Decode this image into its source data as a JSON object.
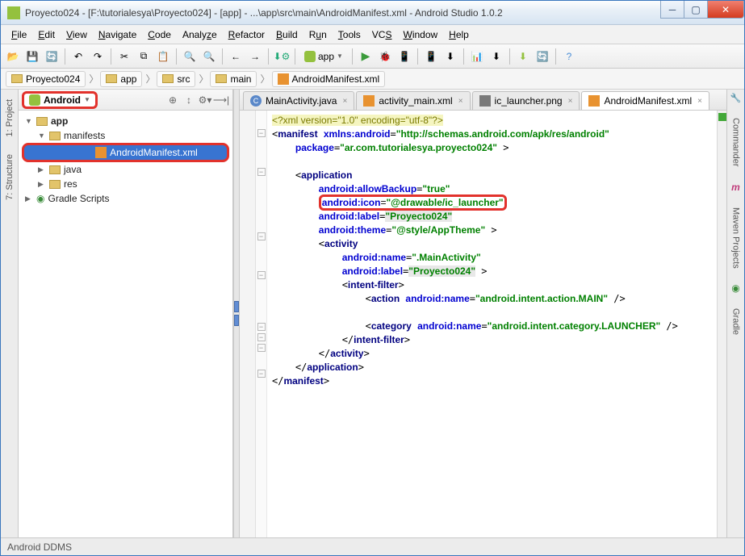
{
  "window": {
    "title": "Proyecto024 - [F:\\tutorialesya\\Proyecto024] - [app] - ...\\app\\src\\main\\AndroidManifest.xml - Android Studio 1.0.2"
  },
  "menu": {
    "file": "File",
    "edit": "Edit",
    "view": "View",
    "navigate": "Navigate",
    "code": "Code",
    "analyze": "Analyze",
    "refactor": "Refactor",
    "build": "Build",
    "run": "Run",
    "tools": "Tools",
    "vcs": "VCS",
    "window": "Window",
    "help": "Help"
  },
  "toolbar": {
    "module": "app"
  },
  "breadcrumbs": [
    {
      "label": "Proyecto024",
      "icon": "folder"
    },
    {
      "label": "app",
      "icon": "folder"
    },
    {
      "label": "src",
      "icon": "folder"
    },
    {
      "label": "main",
      "icon": "folder"
    },
    {
      "label": "AndroidManifest.xml",
      "icon": "xml"
    }
  ],
  "project_dropdown": "Android",
  "tree": {
    "root": "app",
    "manifests": "manifests",
    "manifest_file": "AndroidManifest.xml",
    "java": "java",
    "res": "res",
    "gradle": "Gradle Scripts"
  },
  "editor_tabs": [
    {
      "label": "MainActivity.java",
      "icon": "java",
      "active": false
    },
    {
      "label": "activity_main.xml",
      "icon": "xml",
      "active": false
    },
    {
      "label": "ic_launcher.png",
      "icon": "png",
      "active": false
    },
    {
      "label": "AndroidManifest.xml",
      "icon": "xml",
      "active": true
    }
  ],
  "left_tabs": [
    "1: Project",
    "7: Structure"
  ],
  "right_tabs": [
    "Commander",
    "Maven Projects",
    "Gradle"
  ],
  "status": "Android DDMS",
  "xml": {
    "decl": "<?xml version=\"1.0\" encoding=\"utf-8\"?>",
    "manifest_open": "manifest",
    "xmlns_attr": "xmlns:android",
    "xmlns_val": "\"http://schemas.android.com/apk/res/android\"",
    "package_attr": "package",
    "package_val": "\"ar.com.tutorialesya.proyecto024\"",
    "app": "application",
    "allowBackup_attr": "android:allowBackup",
    "allowBackup_val": "\"true\"",
    "icon_attr": "android:icon",
    "icon_val": "\"@drawable/ic_launcher\"",
    "label_attr": "android:label",
    "label_val": "\"Proyecto024\"",
    "theme_attr": "android:theme",
    "theme_val": "\"@style/AppTheme\"",
    "activity": "activity",
    "act_name_attr": "android:name",
    "act_name_val": "\".MainActivity\"",
    "act_label_attr": "android:label",
    "act_label_val": "\"Proyecto024\"",
    "intent_filter": "intent-filter",
    "action": "action",
    "action_name_attr": "android:name",
    "action_name_val": "\"android.intent.action.MAIN\"",
    "category": "category",
    "cat_name_attr": "android:name",
    "cat_name_val": "\"android.intent.category.LAUNCHER\"",
    "manifest_close": "manifest"
  }
}
